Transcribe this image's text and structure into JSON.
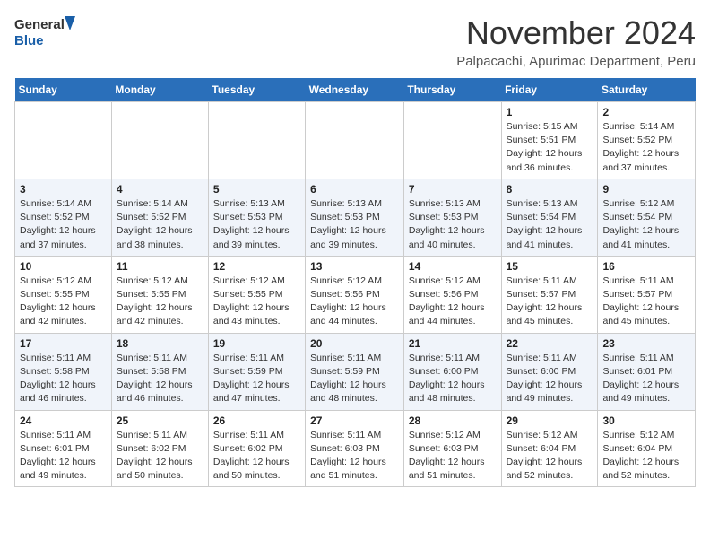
{
  "header": {
    "logo_general": "General",
    "logo_blue": "Blue",
    "month": "November 2024",
    "location": "Palpacachi, Apurimac Department, Peru"
  },
  "days_of_week": [
    "Sunday",
    "Monday",
    "Tuesday",
    "Wednesday",
    "Thursday",
    "Friday",
    "Saturday"
  ],
  "weeks": [
    [
      {
        "day": "",
        "info": ""
      },
      {
        "day": "",
        "info": ""
      },
      {
        "day": "",
        "info": ""
      },
      {
        "day": "",
        "info": ""
      },
      {
        "day": "",
        "info": ""
      },
      {
        "day": "1",
        "info": "Sunrise: 5:15 AM\nSunset: 5:51 PM\nDaylight: 12 hours\nand 36 minutes."
      },
      {
        "day": "2",
        "info": "Sunrise: 5:14 AM\nSunset: 5:52 PM\nDaylight: 12 hours\nand 37 minutes."
      }
    ],
    [
      {
        "day": "3",
        "info": "Sunrise: 5:14 AM\nSunset: 5:52 PM\nDaylight: 12 hours\nand 37 minutes."
      },
      {
        "day": "4",
        "info": "Sunrise: 5:14 AM\nSunset: 5:52 PM\nDaylight: 12 hours\nand 38 minutes."
      },
      {
        "day": "5",
        "info": "Sunrise: 5:13 AM\nSunset: 5:53 PM\nDaylight: 12 hours\nand 39 minutes."
      },
      {
        "day": "6",
        "info": "Sunrise: 5:13 AM\nSunset: 5:53 PM\nDaylight: 12 hours\nand 39 minutes."
      },
      {
        "day": "7",
        "info": "Sunrise: 5:13 AM\nSunset: 5:53 PM\nDaylight: 12 hours\nand 40 minutes."
      },
      {
        "day": "8",
        "info": "Sunrise: 5:13 AM\nSunset: 5:54 PM\nDaylight: 12 hours\nand 41 minutes."
      },
      {
        "day": "9",
        "info": "Sunrise: 5:12 AM\nSunset: 5:54 PM\nDaylight: 12 hours\nand 41 minutes."
      }
    ],
    [
      {
        "day": "10",
        "info": "Sunrise: 5:12 AM\nSunset: 5:55 PM\nDaylight: 12 hours\nand 42 minutes."
      },
      {
        "day": "11",
        "info": "Sunrise: 5:12 AM\nSunset: 5:55 PM\nDaylight: 12 hours\nand 42 minutes."
      },
      {
        "day": "12",
        "info": "Sunrise: 5:12 AM\nSunset: 5:55 PM\nDaylight: 12 hours\nand 43 minutes."
      },
      {
        "day": "13",
        "info": "Sunrise: 5:12 AM\nSunset: 5:56 PM\nDaylight: 12 hours\nand 44 minutes."
      },
      {
        "day": "14",
        "info": "Sunrise: 5:12 AM\nSunset: 5:56 PM\nDaylight: 12 hours\nand 44 minutes."
      },
      {
        "day": "15",
        "info": "Sunrise: 5:11 AM\nSunset: 5:57 PM\nDaylight: 12 hours\nand 45 minutes."
      },
      {
        "day": "16",
        "info": "Sunrise: 5:11 AM\nSunset: 5:57 PM\nDaylight: 12 hours\nand 45 minutes."
      }
    ],
    [
      {
        "day": "17",
        "info": "Sunrise: 5:11 AM\nSunset: 5:58 PM\nDaylight: 12 hours\nand 46 minutes."
      },
      {
        "day": "18",
        "info": "Sunrise: 5:11 AM\nSunset: 5:58 PM\nDaylight: 12 hours\nand 46 minutes."
      },
      {
        "day": "19",
        "info": "Sunrise: 5:11 AM\nSunset: 5:59 PM\nDaylight: 12 hours\nand 47 minutes."
      },
      {
        "day": "20",
        "info": "Sunrise: 5:11 AM\nSunset: 5:59 PM\nDaylight: 12 hours\nand 48 minutes."
      },
      {
        "day": "21",
        "info": "Sunrise: 5:11 AM\nSunset: 6:00 PM\nDaylight: 12 hours\nand 48 minutes."
      },
      {
        "day": "22",
        "info": "Sunrise: 5:11 AM\nSunset: 6:00 PM\nDaylight: 12 hours\nand 49 minutes."
      },
      {
        "day": "23",
        "info": "Sunrise: 5:11 AM\nSunset: 6:01 PM\nDaylight: 12 hours\nand 49 minutes."
      }
    ],
    [
      {
        "day": "24",
        "info": "Sunrise: 5:11 AM\nSunset: 6:01 PM\nDaylight: 12 hours\nand 49 minutes."
      },
      {
        "day": "25",
        "info": "Sunrise: 5:11 AM\nSunset: 6:02 PM\nDaylight: 12 hours\nand 50 minutes."
      },
      {
        "day": "26",
        "info": "Sunrise: 5:11 AM\nSunset: 6:02 PM\nDaylight: 12 hours\nand 50 minutes."
      },
      {
        "day": "27",
        "info": "Sunrise: 5:11 AM\nSunset: 6:03 PM\nDaylight: 12 hours\nand 51 minutes."
      },
      {
        "day": "28",
        "info": "Sunrise: 5:12 AM\nSunset: 6:03 PM\nDaylight: 12 hours\nand 51 minutes."
      },
      {
        "day": "29",
        "info": "Sunrise: 5:12 AM\nSunset: 6:04 PM\nDaylight: 12 hours\nand 52 minutes."
      },
      {
        "day": "30",
        "info": "Sunrise: 5:12 AM\nSunset: 6:04 PM\nDaylight: 12 hours\nand 52 minutes."
      }
    ]
  ]
}
